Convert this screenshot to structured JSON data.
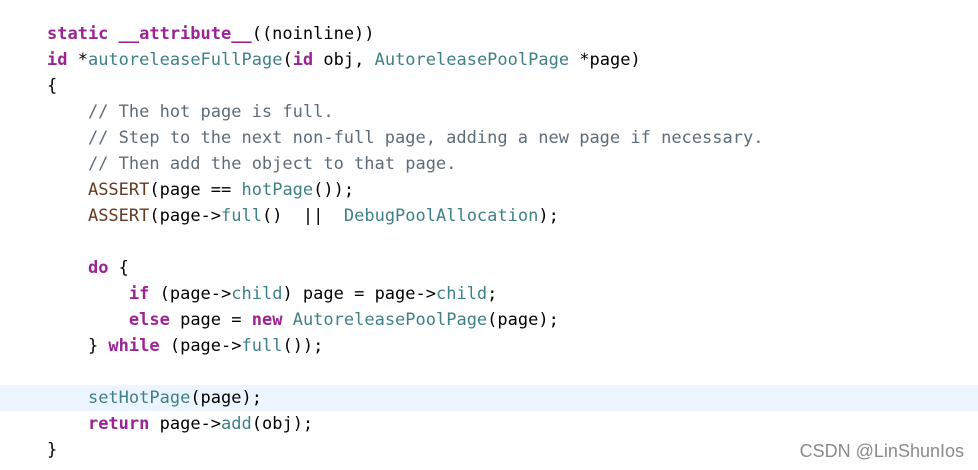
{
  "code": {
    "lines": [
      [
        {
          "t": "static __attribute__",
          "k": "kw"
        },
        {
          "t": "((noinline))",
          "k": "tx"
        }
      ],
      [
        {
          "t": "id",
          "k": "kw"
        },
        {
          "t": " *",
          "k": "tx"
        },
        {
          "t": "autoreleaseFullPage",
          "k": "fn"
        },
        {
          "t": "(",
          "k": "tx"
        },
        {
          "t": "id",
          "k": "kw"
        },
        {
          "t": " obj, ",
          "k": "tx"
        },
        {
          "t": "AutoreleasePoolPage",
          "k": "fn"
        },
        {
          "t": " *page)",
          "k": "tx"
        }
      ],
      [
        {
          "t": "{",
          "k": "tx"
        }
      ],
      [
        {
          "t": "    // The hot page is full.",
          "k": "cm"
        }
      ],
      [
        {
          "t": "    // Step to the next non-full page, adding a new page if necessary.",
          "k": "cm"
        }
      ],
      [
        {
          "t": "    // Then add the object to that page.",
          "k": "cm"
        }
      ],
      [
        {
          "t": "    ",
          "k": "tx"
        },
        {
          "t": "ASSERT",
          "k": "mac"
        },
        {
          "t": "(page == ",
          "k": "tx"
        },
        {
          "t": "hotPage",
          "k": "fn"
        },
        {
          "t": "());",
          "k": "tx"
        }
      ],
      [
        {
          "t": "    ",
          "k": "tx"
        },
        {
          "t": "ASSERT",
          "k": "mac"
        },
        {
          "t": "(page->",
          "k": "tx"
        },
        {
          "t": "full",
          "k": "fn"
        },
        {
          "t": "()  ||  ",
          "k": "tx"
        },
        {
          "t": "DebugPoolAllocation",
          "k": "fn"
        },
        {
          "t": ");",
          "k": "tx"
        }
      ],
      [],
      [
        {
          "t": "    ",
          "k": "tx"
        },
        {
          "t": "do",
          "k": "kw"
        },
        {
          "t": " {",
          "k": "tx"
        }
      ],
      [
        {
          "t": "        ",
          "k": "tx"
        },
        {
          "t": "if",
          "k": "kw"
        },
        {
          "t": " (page->",
          "k": "tx"
        },
        {
          "t": "child",
          "k": "fn"
        },
        {
          "t": ") page = page->",
          "k": "tx"
        },
        {
          "t": "child",
          "k": "fn"
        },
        {
          "t": ";",
          "k": "tx"
        }
      ],
      [
        {
          "t": "        ",
          "k": "tx"
        },
        {
          "t": "else",
          "k": "kw"
        },
        {
          "t": " page = ",
          "k": "tx"
        },
        {
          "t": "new",
          "k": "kw"
        },
        {
          "t": " ",
          "k": "tx"
        },
        {
          "t": "AutoreleasePoolPage",
          "k": "fn"
        },
        {
          "t": "(page);",
          "k": "tx"
        }
      ],
      [
        {
          "t": "    } ",
          "k": "tx"
        },
        {
          "t": "while",
          "k": "kw"
        },
        {
          "t": " (page->",
          "k": "tx"
        },
        {
          "t": "full",
          "k": "fn"
        },
        {
          "t": "());",
          "k": "tx"
        }
      ],
      [],
      [
        {
          "t": "    ",
          "k": "tx"
        },
        {
          "t": "setHotPage",
          "k": "fn"
        },
        {
          "t": "(page);",
          "k": "tx"
        }
      ],
      [
        {
          "t": "    ",
          "k": "tx"
        },
        {
          "t": "return",
          "k": "kw"
        },
        {
          "t": " page->",
          "k": "tx"
        },
        {
          "t": "add",
          "k": "fn"
        },
        {
          "t": "(obj);",
          "k": "tx"
        }
      ],
      [
        {
          "t": "}",
          "k": "tx"
        }
      ]
    ],
    "current_line": 14
  },
  "watermark": "CSDN @LinShunIos",
  "colors": {
    "keyword": "#9b2393",
    "function": "#3e8087",
    "macro": "#643820",
    "comment": "#5d6c79",
    "current_line_bg": "#ecf5ff"
  }
}
